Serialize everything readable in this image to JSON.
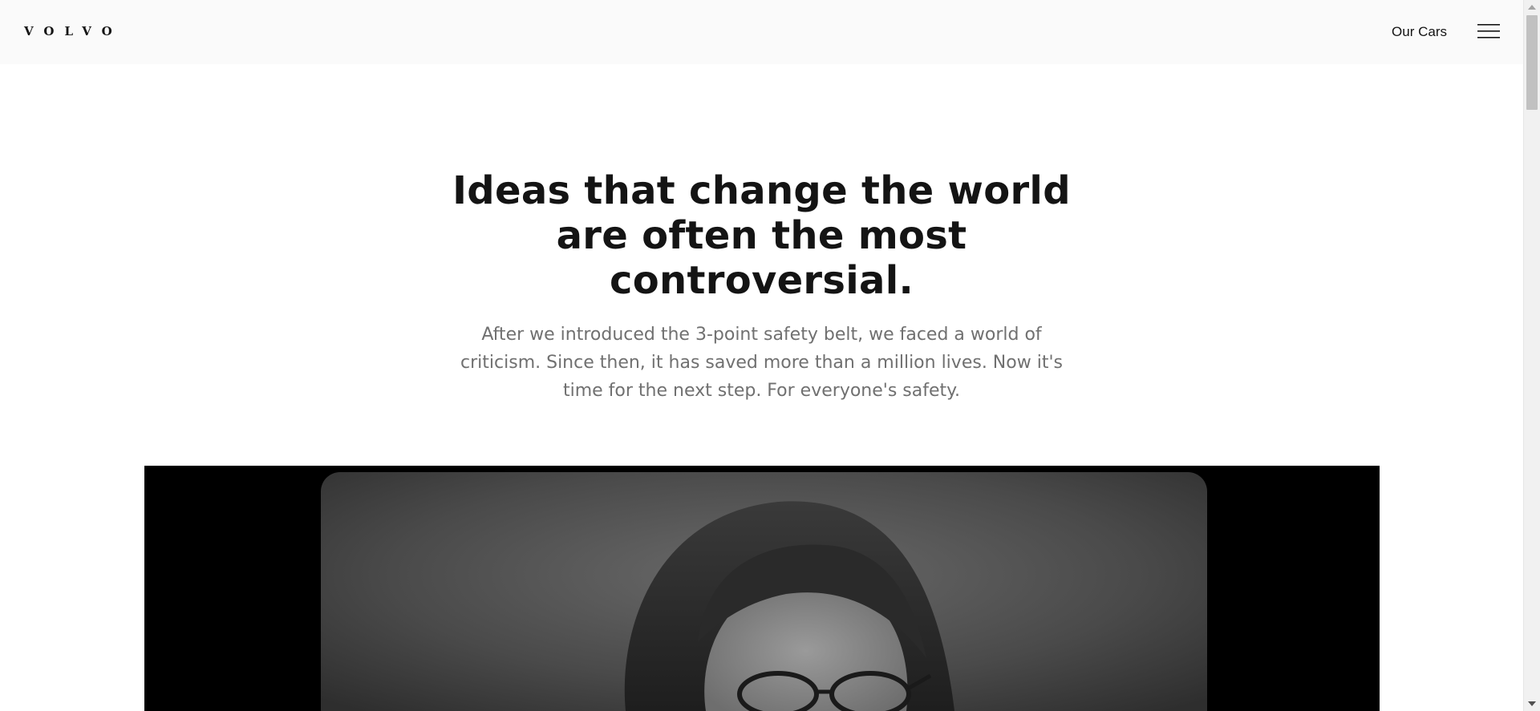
{
  "header": {
    "logo_text": "VOLVO",
    "nav_label": "Our Cars",
    "menu_icon": "hamburger-menu-icon"
  },
  "hero": {
    "title": "Ideas that change the world are often the most controversial.",
    "body": "After we introduced the 3-point safety belt, we faced a world of criticism. Since then, it has saved more than a million lives. Now it's time for the next step. For everyone's safety."
  },
  "media": {
    "kind": "black-and-white video still of a woman with glasses"
  },
  "colors": {
    "header_bg": "#fafafa",
    "text_primary": "#141414",
    "text_secondary": "#707070",
    "media_bg": "#000000"
  }
}
